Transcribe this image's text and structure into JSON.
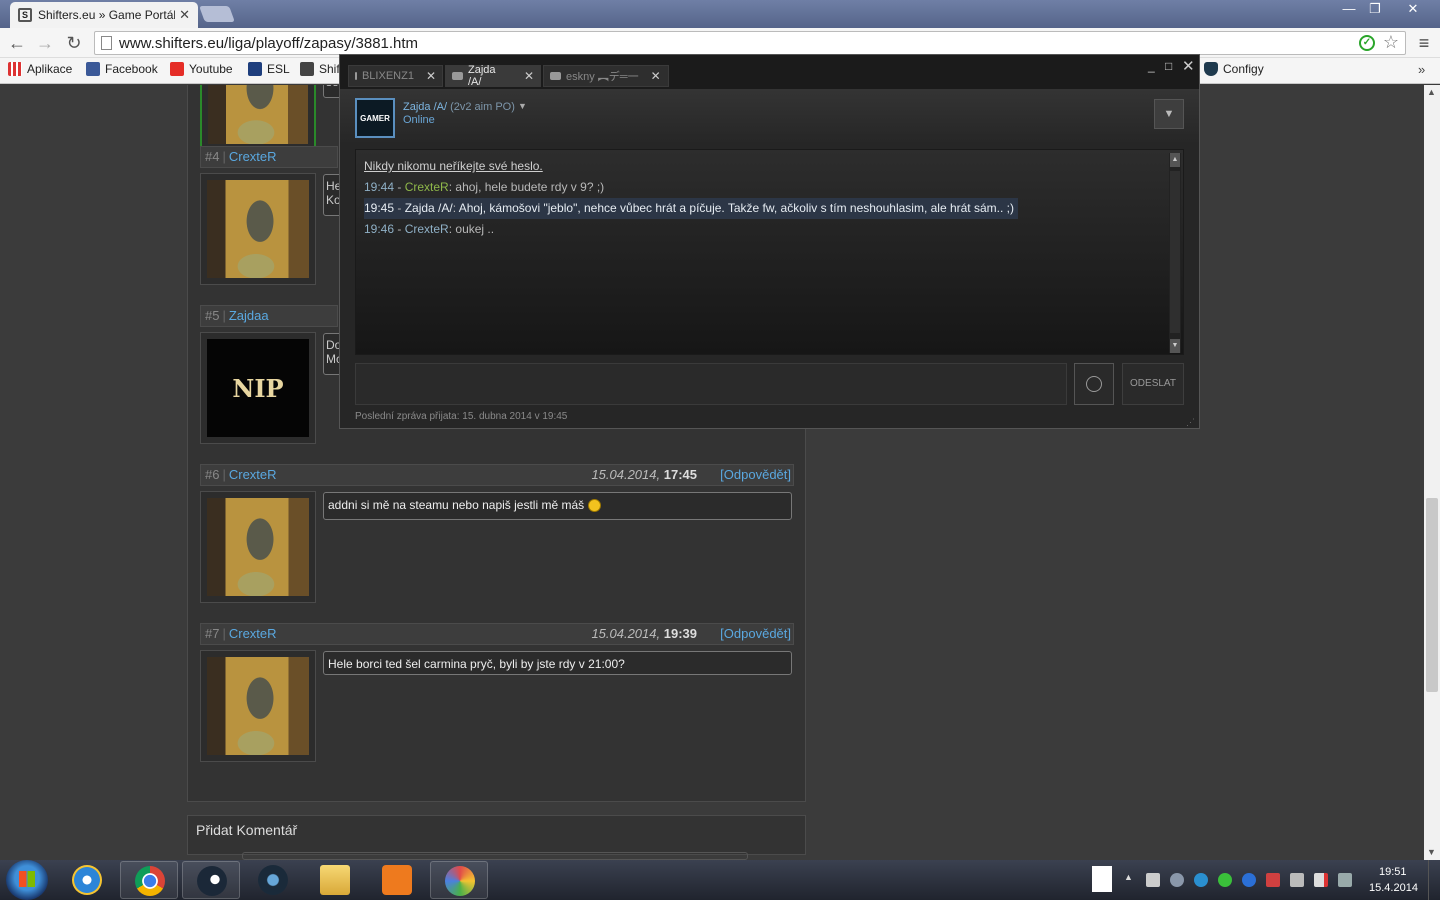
{
  "browser": {
    "tab_title": "Shifters.eu » Game Portál ·",
    "tab_favicon": "S",
    "url": "www.shifters.eu/liga/playoff/zapasy/3881.htm",
    "bookmarks": [
      "Aplikace",
      "Facebook",
      "Youtube",
      "ESL",
      "Shif",
      "Configy"
    ],
    "bookmarks_more": "»"
  },
  "page": {
    "comments": [
      {
        "num": "#4",
        "nick": "CrexteR",
        "stub_text": "He Ko",
        "avatar": "gasmask-photo"
      },
      {
        "num": "#5",
        "nick": "Zajdaa",
        "stub_text": "Do Mc",
        "avatar": "nip-logo"
      },
      {
        "num": "#6",
        "nick": "CrexteR",
        "date": "15.04.2014,",
        "time": "17:45",
        "reply": "[Odpovědět]",
        "text": "addni si mě na steamu nebo napiš jestli mě máš",
        "avatar": "gasmask-photo"
      },
      {
        "num": "#7",
        "nick": "CrexteR",
        "date": "15.04.2014,",
        "time": "19:39",
        "reply": "[Odpovědět]",
        "text": "Hele borci ted šel carmina pryč, byli by jste rdy v 21:00?",
        "avatar": "gasmask-photo"
      }
    ],
    "top_stub": "se",
    "separator": "|",
    "avatar_logo_text": "NIP",
    "add_comment_title": "Přidat Komentář"
  },
  "steam_chat": {
    "tabs": [
      {
        "label": "BLIXENZ1",
        "active": false
      },
      {
        "label": "Zajda /A/",
        "active": true
      },
      {
        "label": "eskny ︻デ═一",
        "active": false
      }
    ],
    "friend_name": "Zajda /A/",
    "friend_game": "(2v2 aim PO)",
    "friend_status": "Online",
    "avatar_text": "GAMER",
    "warning": "Nikdy nikomu neříkejte své heslo.",
    "messages": [
      {
        "time": "19:44",
        "sender": "CrexteR",
        "text": "ahoj, hele budete rdy v 9? ;)",
        "self": true,
        "highlight": false
      },
      {
        "time": "19:45",
        "sender": "Zajda /A/",
        "text": "Ahoj, kámošovi \"jeblo\", nehce vůbec hrát a píčuje. Takže fw, ačkoliv s tím neshouhlasim, ale hrát sám.. ;)",
        "self": false,
        "highlight": true
      },
      {
        "time": "19:46",
        "sender": "CrexteR",
        "text": "oukej ..",
        "self": false,
        "highlight": false
      }
    ],
    "send_label": "ODESLAT",
    "footer": "Poslední zpráva přijata: 15. dubna 2014 v 19:45"
  },
  "taskbar": {
    "apps": [
      "start-button",
      "internet-explorer",
      "chrome",
      "steam",
      "app",
      "file-explorer",
      "media-player",
      "paint"
    ],
    "clock_time": "19:51",
    "clock_date": "15.4.2014"
  },
  "colors": {
    "link": "#5aa8e0",
    "steam_bg": "#262626",
    "self_name": "#8fb84a",
    "highlight_row": "#2c3646"
  }
}
